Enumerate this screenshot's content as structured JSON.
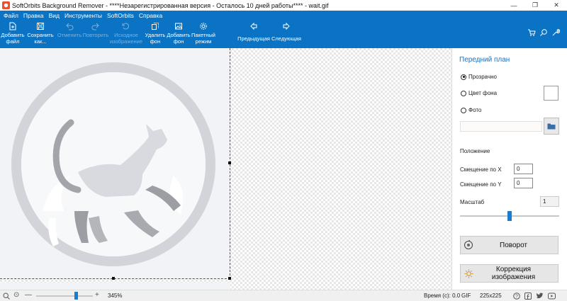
{
  "window": {
    "title": "SoftOrbits Background Remover - ****Незарегистрированная версия - Осталось 10 дней работы**** - wait.gif"
  },
  "menu": [
    "Файл",
    "Правка",
    "Вид",
    "Инструменты",
    "SoftOrbits",
    "Справка"
  ],
  "toolbar": {
    "add_file": "Добавить\nфайл",
    "save_as": "Сохранить\nкак...",
    "undo": "Отменить",
    "redo": "Повторить",
    "original": "Исходное\nизображение",
    "remove_bg": "Удалить\nфон",
    "add_bg": "Добавить\nфон",
    "batch": "Пакетный\nрежим",
    "prev": "Предыдущая",
    "next": "Следующая"
  },
  "panel": {
    "title": "Передний план",
    "transparent": "Прозрачно",
    "bg_color": "Цвет фона",
    "photo": "Фото",
    "position_title": "Положение",
    "offset_x_label": "Смещение по X",
    "offset_x": "0",
    "offset_y_label": "Смещение по Y",
    "offset_y": "0",
    "scale_label": "Масштаб",
    "scale_value": "1",
    "scale_slider_fraction": 0.5,
    "rotate_btn": "Поворот",
    "correction_btn": "Коррекция изображения"
  },
  "status": {
    "zoom": "345%",
    "zoom_slider_fraction": 0.7,
    "time": "Время (с): 0.0",
    "format": "GIF",
    "size": "225x225"
  },
  "colors": {
    "accent": "#0a73c4",
    "selected": "#1a7cd0"
  }
}
